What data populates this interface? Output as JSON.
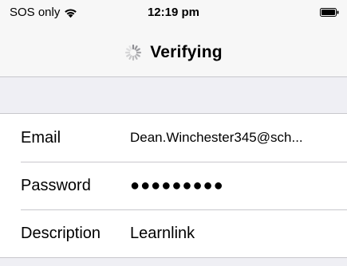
{
  "status_bar": {
    "carrier": "SOS only",
    "time": "12:19 pm",
    "wifi_icon": "wifi-icon",
    "battery_icon": "battery-full-icon"
  },
  "nav": {
    "title": "Verifying",
    "spinner_icon": "activity-spinner-icon"
  },
  "form": {
    "rows": [
      {
        "label": "Email",
        "value": "Dean.Winchester345@sch..."
      },
      {
        "label": "Password",
        "value": "●●●●●●●●●"
      },
      {
        "label": "Description",
        "value": "Learnlink"
      }
    ]
  },
  "colors": {
    "nav_background": "#f7f7f7",
    "group_background": "#efeff4",
    "separator": "#c8c7cc",
    "cell_background": "#ffffff",
    "text": "#000000"
  }
}
